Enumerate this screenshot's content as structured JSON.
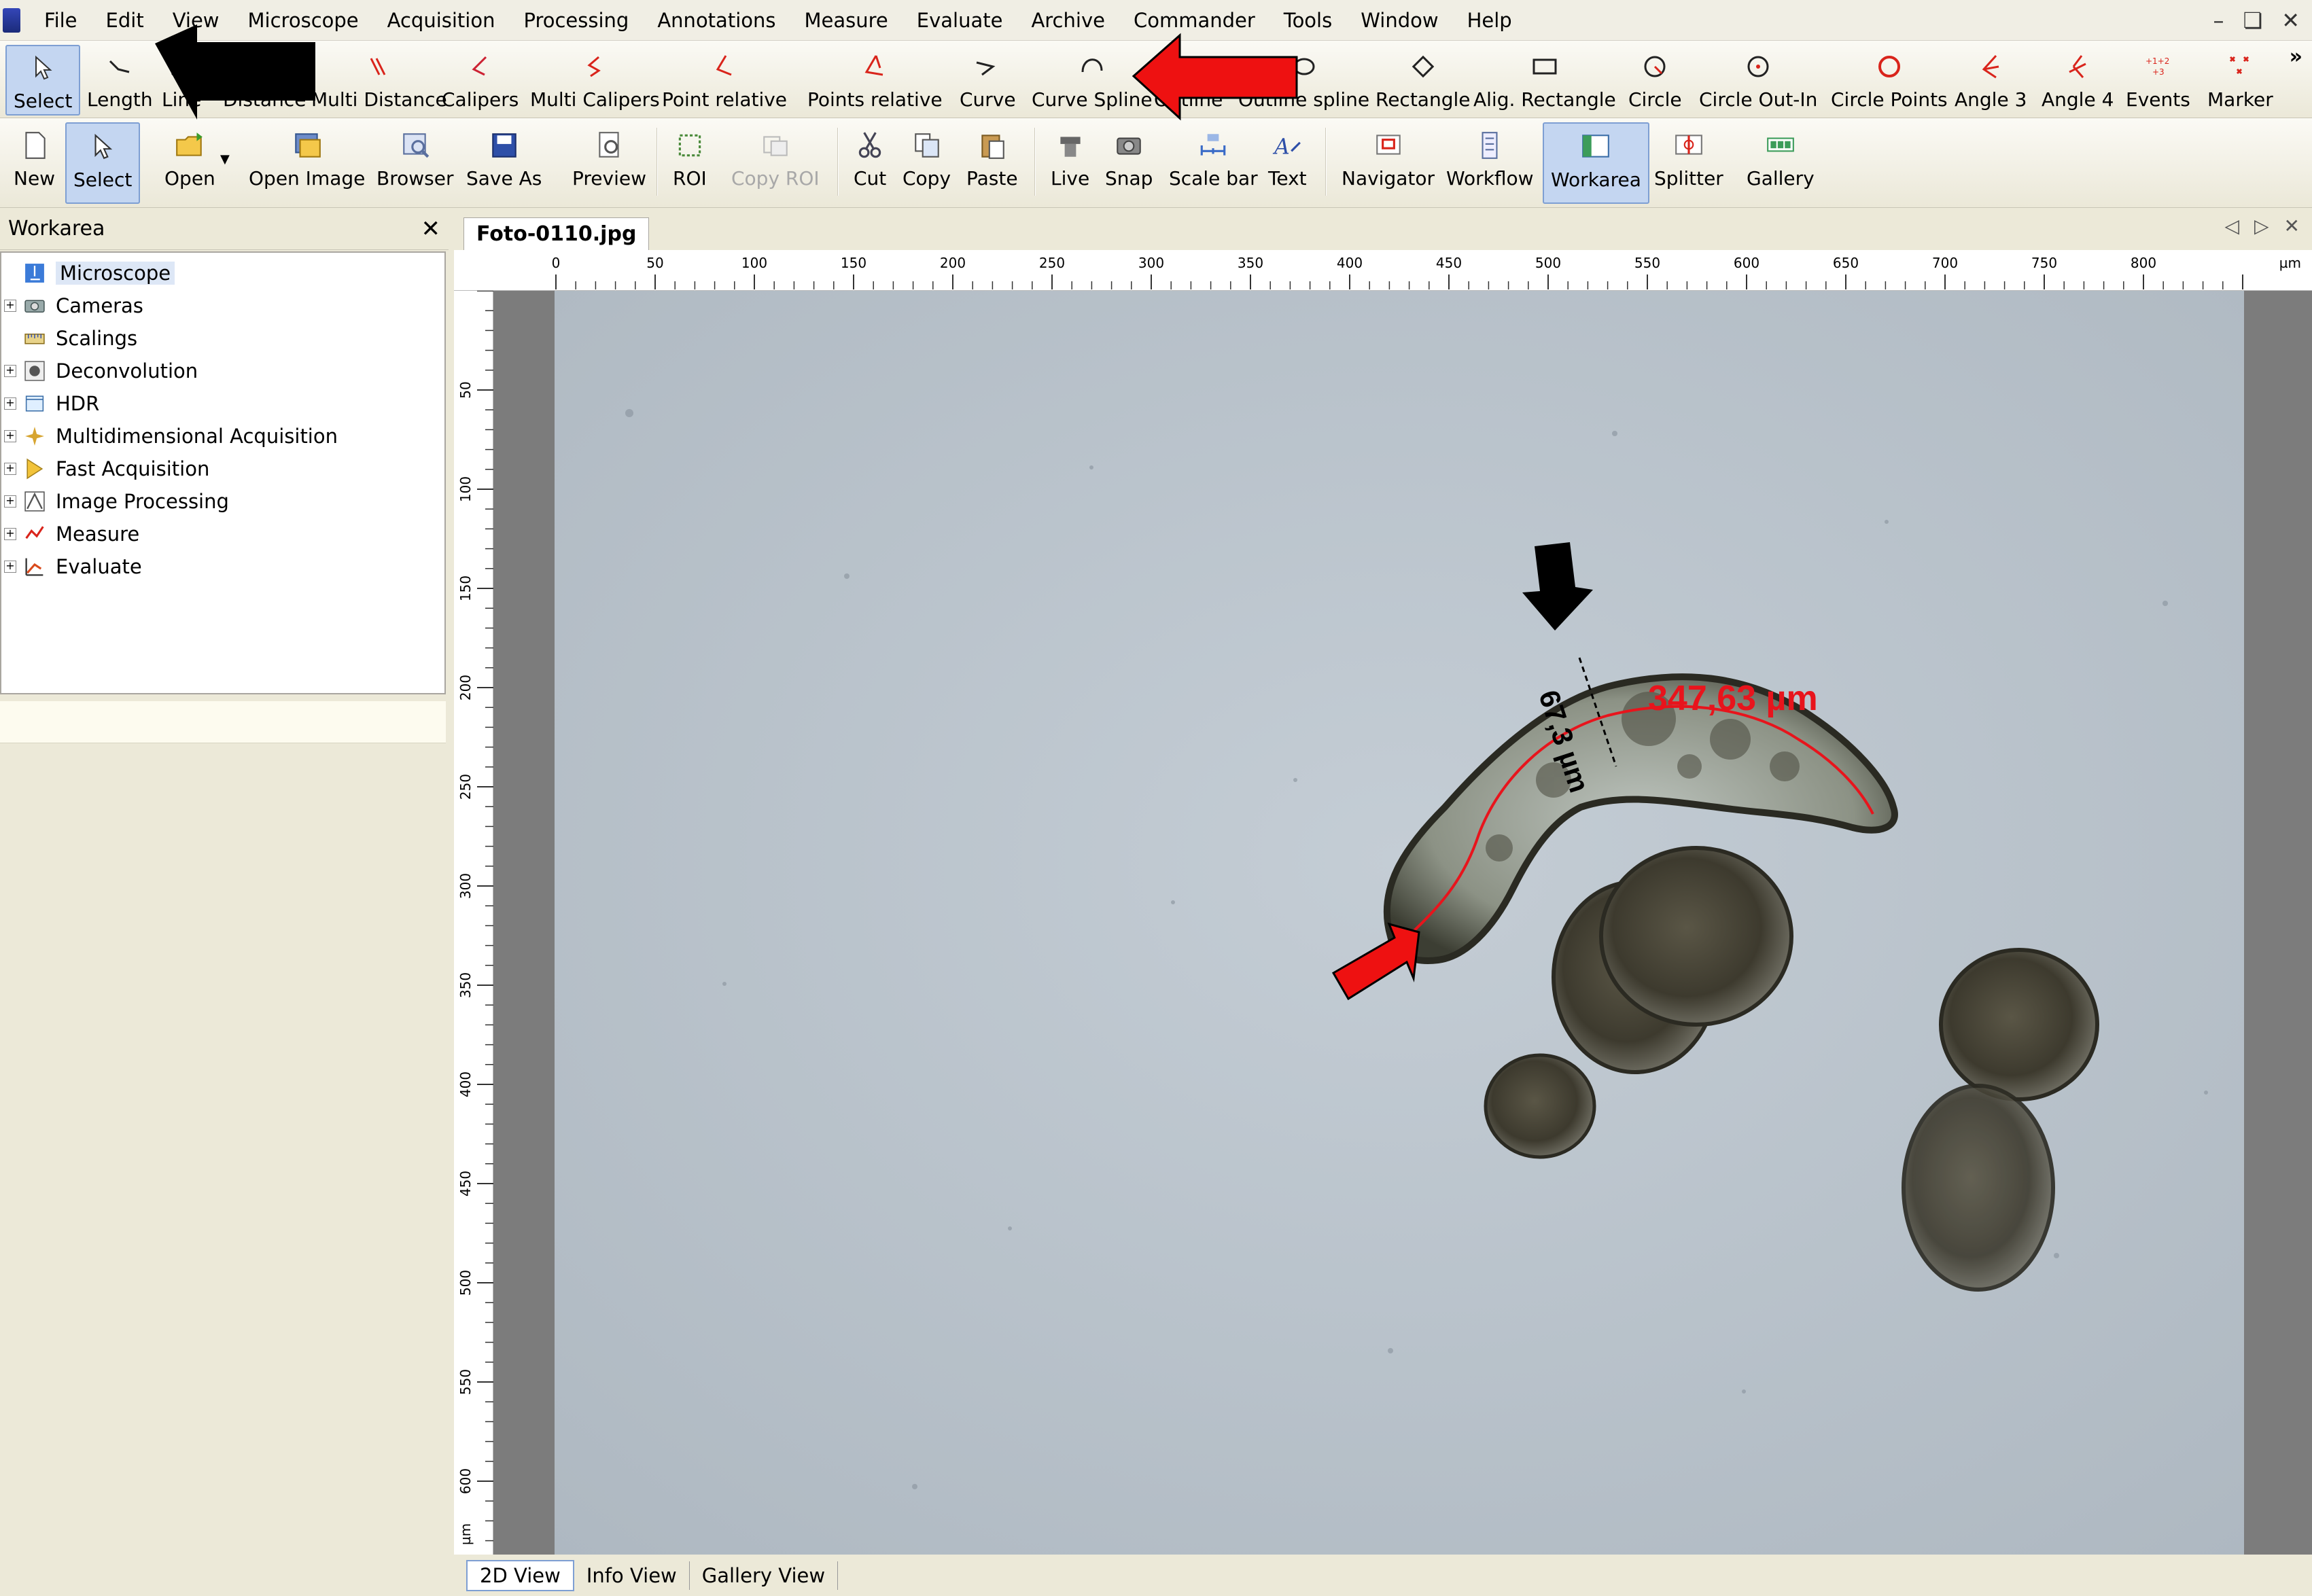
{
  "menu": [
    "File",
    "Edit",
    "View",
    "Microscope",
    "Acquisition",
    "Processing",
    "Annotations",
    "Measure",
    "Evaluate",
    "Archive",
    "Commander",
    "Tools",
    "Window",
    "Help"
  ],
  "annotation_toolbar": [
    {
      "label": "Select",
      "icon": "cursor-icon"
    },
    {
      "label": "Length",
      "icon": "length-icon"
    },
    {
      "label": "Line",
      "icon": "line-icon"
    },
    {
      "label": "Distance",
      "icon": "distance-icon"
    },
    {
      "label": "Multi Distance",
      "icon": "multi-distance-icon"
    },
    {
      "label": "Calipers",
      "icon": "calipers-icon"
    },
    {
      "label": "Multi Calipers",
      "icon": "multi-calipers-icon"
    },
    {
      "label": "Point relative",
      "icon": "point-relative-icon"
    },
    {
      "label": "Points relative",
      "icon": "points-relative-icon"
    },
    {
      "label": "Curve",
      "icon": "curve-icon"
    },
    {
      "label": "Curve Spline",
      "icon": "curve-spline-icon"
    },
    {
      "label": "Outline",
      "icon": "outline-icon"
    },
    {
      "label": "Outline spline",
      "icon": "outline-spline-icon"
    },
    {
      "label": "Rectangle",
      "icon": "rectangle-icon"
    },
    {
      "label": "Alig. Rectangle",
      "icon": "aligned-rectangle-icon"
    },
    {
      "label": "Circle",
      "icon": "circle-icon"
    },
    {
      "label": "Circle Out-In",
      "icon": "circle-out-in-icon"
    },
    {
      "label": "Circle Points",
      "icon": "circle-points-icon"
    },
    {
      "label": "Angle 3",
      "icon": "angle3-icon"
    },
    {
      "label": "Angle 4",
      "icon": "angle4-icon"
    },
    {
      "label": "Events",
      "icon": "events-icon"
    },
    {
      "label": "Marker",
      "icon": "marker-icon"
    }
  ],
  "main_toolbar": [
    {
      "label": "New",
      "icon": "new-file-icon"
    },
    {
      "label": "Select",
      "icon": "cursor-icon"
    },
    {
      "label": "Open",
      "icon": "open-folder-icon"
    },
    {
      "label": "Open Image",
      "icon": "open-image-icon"
    },
    {
      "label": "Browser",
      "icon": "browser-icon"
    },
    {
      "label": "Save As",
      "icon": "save-icon"
    },
    {
      "label": "Preview",
      "icon": "preview-icon"
    },
    {
      "label": "ROI",
      "icon": "roi-icon"
    },
    {
      "label": "Copy ROI",
      "icon": "copy-roi-icon"
    },
    {
      "label": "Cut",
      "icon": "scissors-icon"
    },
    {
      "label": "Copy",
      "icon": "copy-icon"
    },
    {
      "label": "Paste",
      "icon": "paste-icon"
    },
    {
      "label": "Live",
      "icon": "live-camera-icon"
    },
    {
      "label": "Snap",
      "icon": "snap-camera-icon"
    },
    {
      "label": "Scale bar",
      "icon": "scale-bar-icon"
    },
    {
      "label": "Text",
      "icon": "text-icon"
    },
    {
      "label": "Navigator",
      "icon": "navigator-icon"
    },
    {
      "label": "Workflow",
      "icon": "workflow-icon"
    },
    {
      "label": "Workarea",
      "icon": "workarea-icon"
    },
    {
      "label": "Splitter",
      "icon": "splitter-icon"
    },
    {
      "label": "Gallery",
      "icon": "gallery-icon"
    }
  ],
  "workarea": {
    "title": "Workarea",
    "items": [
      {
        "label": "Microscope",
        "icon": "microscope-icon"
      },
      {
        "label": "Cameras",
        "icon": "camera-icon"
      },
      {
        "label": "Scalings",
        "icon": "scalings-icon"
      },
      {
        "label": "Deconvolution",
        "icon": "deconvolution-icon"
      },
      {
        "label": "HDR",
        "icon": "hdr-icon"
      },
      {
        "label": "Multidimensional Acquisition",
        "icon": "multidim-icon"
      },
      {
        "label": "Fast Acquisition",
        "icon": "fast-acquisition-icon"
      },
      {
        "label": "Image Processing",
        "icon": "image-processing-icon"
      },
      {
        "label": "Measure",
        "icon": "measure-icon"
      },
      {
        "label": "Evaluate",
        "icon": "evaluate-icon"
      }
    ]
  },
  "document": {
    "tab": "Foto-0110.jpg",
    "ruler_top_labels": [
      "0",
      "50",
      "100",
      "150",
      "200",
      "250",
      "300",
      "350",
      "400",
      "450",
      "500",
      "550",
      "600",
      "650",
      "700",
      "750",
      "800"
    ],
    "ruler_top_unit": "µm",
    "ruler_left_labels": [
      "50",
      "100",
      "150",
      "200",
      "250",
      "300",
      "350",
      "400",
      "450",
      "500",
      "550",
      "600"
    ],
    "ruler_left_unit": "µm",
    "measurements": {
      "curve_length": "347,63 µm",
      "width": "67,3 µm"
    },
    "bottom_tabs": [
      "2D View",
      "Info View",
      "Gallery View"
    ]
  },
  "colors": {
    "measure_red": "#e8141c",
    "annotation_arrow_red": "#ee1111",
    "annotation_arrow_black": "#000000"
  }
}
